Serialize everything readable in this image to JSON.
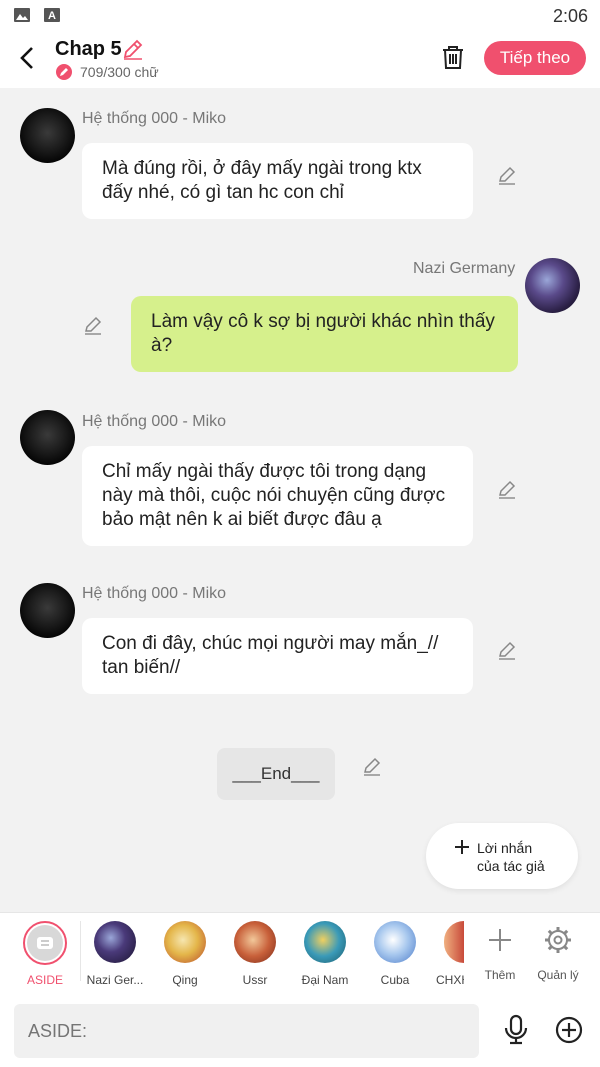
{
  "status": {
    "time": "2:06"
  },
  "header": {
    "title": "Chap 5",
    "word_count": "709/300 chữ",
    "next_label": "Tiếp theo"
  },
  "messages": [
    {
      "sender": "Hệ thống 000 - Miko",
      "text": "Mà đúng rồi, ở đây mấy ngài trong ktx đấy nhé, có gì tan hc con chỉ",
      "side": "left"
    },
    {
      "sender": "Nazi Germany",
      "text": "Làm vậy cô k sợ bị người khác nhìn thấy à?",
      "side": "right"
    },
    {
      "sender": "Hệ thống 000 - Miko",
      "text": "Chỉ mấy ngài thấy được tôi trong dạng này mà thôi, cuộc nói chuyện cũng được bảo mật nên k ai biết được đâu ạ",
      "side": "left"
    },
    {
      "sender": "Hệ thống 000 - Miko",
      "text": "Con đi đây, chúc mọi người may mắn_// tan biến//",
      "side": "left"
    }
  ],
  "end_text": "___End___",
  "author_note": {
    "line1": "Lời nhắn",
    "line2": "của tác giả"
  },
  "characters": [
    {
      "name": "ASIDE",
      "color": "#f0506e"
    },
    {
      "name": "Nazi Ger...",
      "color": "#444444"
    },
    {
      "name": "Qing",
      "color": "#444444"
    },
    {
      "name": "Ussr",
      "color": "#444444"
    },
    {
      "name": "Đại Nam",
      "color": "#444444"
    },
    {
      "name": "Cuba",
      "color": "#444444"
    },
    {
      "name": "CHXH",
      "color": "#444444"
    }
  ],
  "tools": {
    "add_label": "Thêm",
    "manage_label": "Quản lý"
  },
  "input": {
    "placeholder": "ASIDE:"
  },
  "colors": {
    "accent": "#f0506e",
    "bubble_green": "#d6f08c"
  }
}
